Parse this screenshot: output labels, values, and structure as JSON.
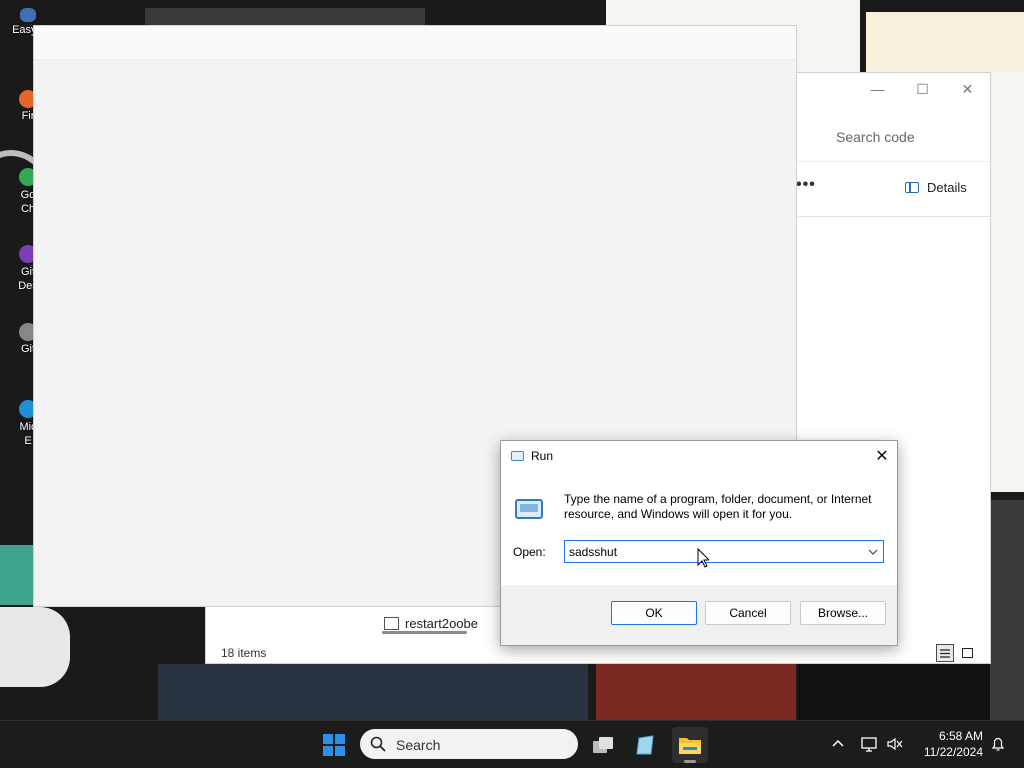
{
  "desktop": {
    "icons": [
      {
        "label": "EasyB",
        "icon": "easybcd-icon"
      },
      {
        "label": "Fir",
        "icon": "firefox-icon"
      },
      {
        "label": "Go",
        "icon": "chrome-icon"
      },
      {
        "label": "Ch",
        "icon": "chrome-icon"
      },
      {
        "label": "Git",
        "icon": "github-desktop-icon"
      },
      {
        "label": "Des",
        "icon": "github-desktop-icon"
      },
      {
        "label": "Git",
        "icon": "git-icon"
      },
      {
        "label": "Mic",
        "icon": "edge-icon"
      },
      {
        "label": "E",
        "icon": "edge-icon"
      }
    ]
  },
  "explorer": {
    "search_placeholder": "Search code",
    "more_label": "•••",
    "details_label": "Details",
    "file_row_fragment": "restart2oobe",
    "status": "18 items",
    "window_controls": [
      "minimize-icon",
      "maximize-icon",
      "close-icon"
    ]
  },
  "run_dialog": {
    "title": "Run",
    "description": "Type the name of a program, folder, document, or Internet resource, and Windows will open it for you.",
    "open_label": "Open:",
    "open_value": "sadsshut",
    "ok_label": "OK",
    "cancel_label": "Cancel",
    "browse_label": "Browse...",
    "accent": "#1a73e8"
  },
  "taskbar": {
    "search_placeholder": "Search",
    "apps": [
      "task-view-icon",
      "app-icon",
      "file-explorer-icon"
    ],
    "active_app": "file-explorer-icon",
    "time": "6:58 AM",
    "date": "11/22/2024",
    "background": "#1c1c1c"
  }
}
